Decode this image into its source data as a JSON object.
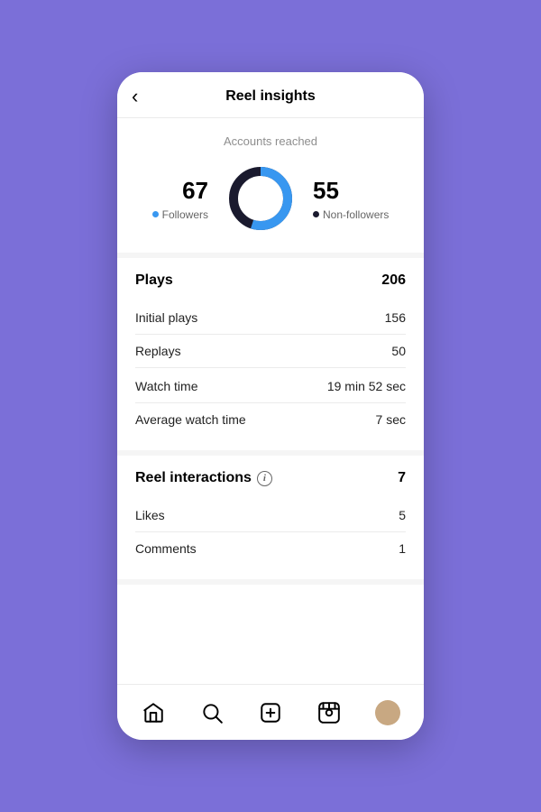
{
  "header": {
    "title": "Reel insights",
    "back_label": "‹"
  },
  "accounts_reached": {
    "subtitle": "Accounts reached",
    "followers_count": "67",
    "followers_label": "Followers",
    "non_followers_count": "55",
    "non_followers_label": "Non-followers",
    "chart": {
      "followers_pct": 55,
      "non_followers_pct": 45
    }
  },
  "plays": {
    "section_title": "Plays",
    "total": "206",
    "rows": [
      {
        "label": "Initial plays",
        "value": "156"
      },
      {
        "label": "Replays",
        "value": "50"
      }
    ]
  },
  "watch_time": {
    "rows": [
      {
        "label": "Watch time",
        "value": "19 min 52 sec"
      },
      {
        "label": "Average watch time",
        "value": "7 sec"
      }
    ]
  },
  "reel_interactions": {
    "section_title": "Reel interactions",
    "total": "7",
    "rows": [
      {
        "label": "Likes",
        "value": "5"
      },
      {
        "label": "Comments",
        "value": "1"
      }
    ]
  },
  "nav": {
    "items": [
      "home",
      "search",
      "add",
      "reels",
      "profile"
    ]
  }
}
